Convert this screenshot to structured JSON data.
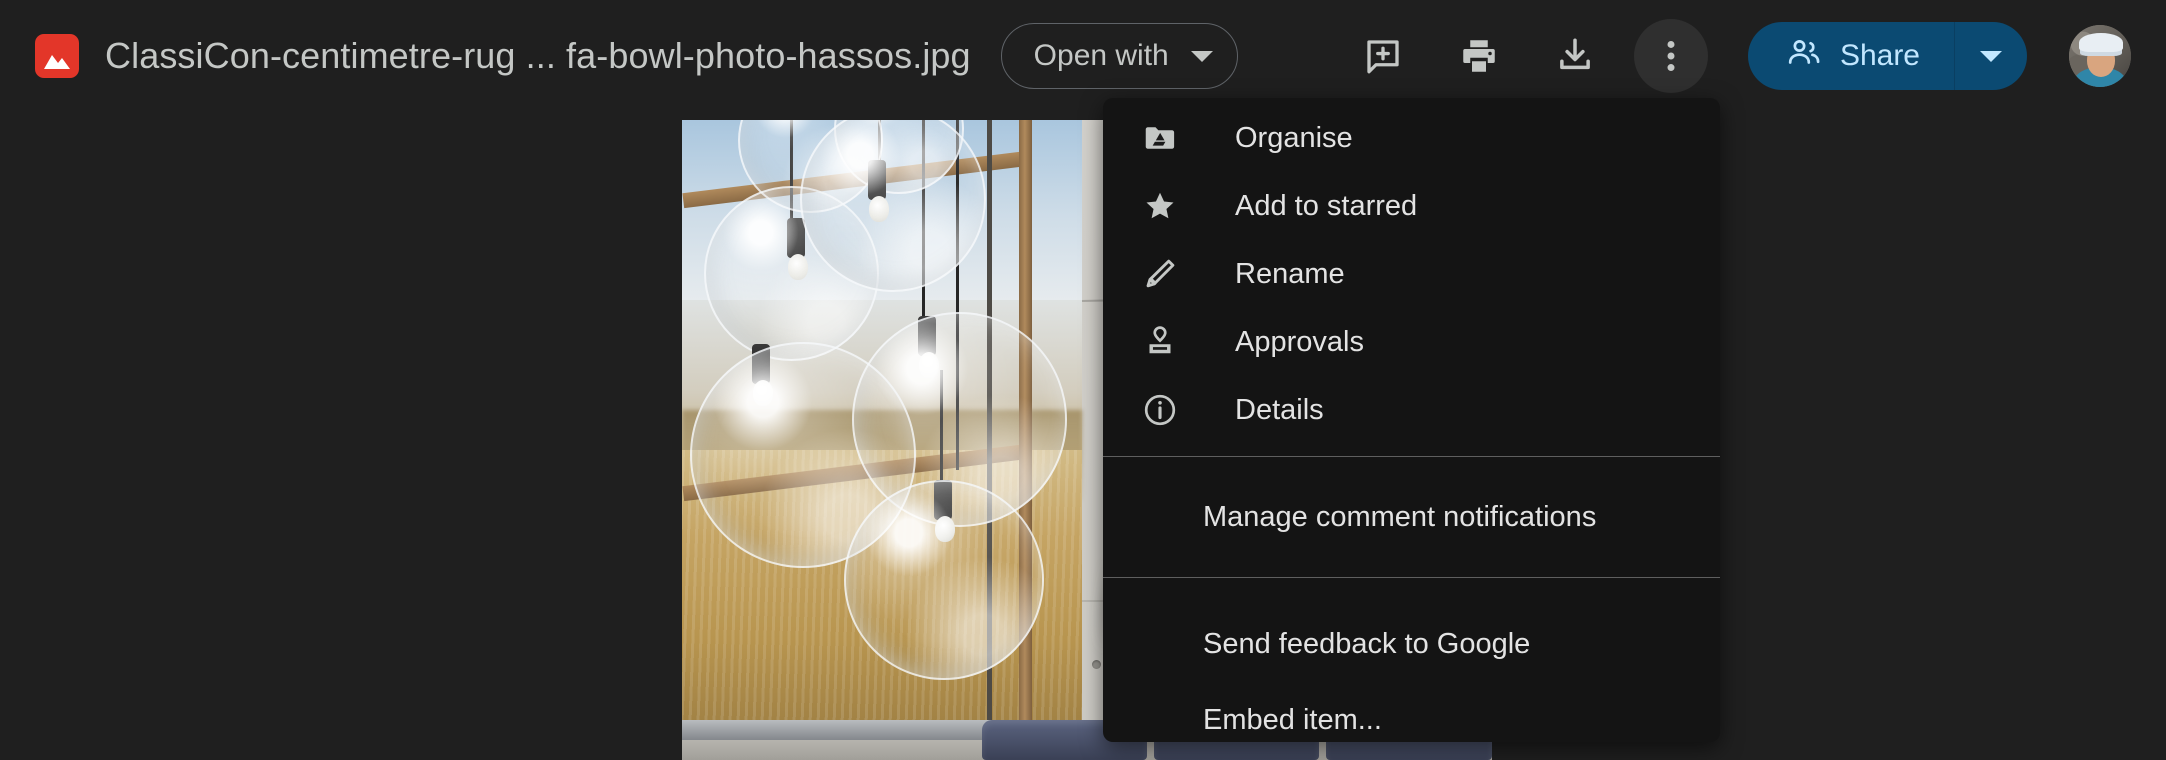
{
  "app": {
    "background_color": "#1f1f1f",
    "file_type_icon": "image-file-icon",
    "title": "ClassiCon-centimetre-rug ... fa-bowl-photo-hassos.jpg"
  },
  "toolbar": {
    "open_with": {
      "label": "Open with",
      "caret_icon": "chevron-down-icon"
    },
    "actions": [
      {
        "name": "add-comment-icon",
        "tooltip": "Add a comment"
      },
      {
        "name": "print-icon",
        "tooltip": "Print"
      },
      {
        "name": "download-icon",
        "tooltip": "Download"
      },
      {
        "name": "more-actions-icon",
        "tooltip": "More actions",
        "active": true
      }
    ],
    "share": {
      "label": "Share",
      "icon": "people-icon",
      "caret_icon": "chevron-down-icon",
      "background_color": "#0b4a72",
      "text_color": "#c2e7ff"
    },
    "avatar": {
      "name": "account-avatar",
      "alt": "Account profile photo"
    }
  },
  "menu": {
    "background_color": "#141414",
    "groups": [
      {
        "items": [
          {
            "label": "Organise",
            "icon": "drive-folder-icon"
          },
          {
            "label": "Add to starred",
            "icon": "star-icon"
          },
          {
            "label": "Rename",
            "icon": "pencil-icon"
          },
          {
            "label": "Approvals",
            "icon": "stamp-icon"
          },
          {
            "label": "Details",
            "icon": "info-circle-icon"
          }
        ]
      },
      {
        "items": [
          {
            "label": "Manage comment notifications",
            "icon": ""
          }
        ]
      },
      {
        "items": [
          {
            "label": "Send feedback to Google",
            "icon": ""
          },
          {
            "label": "Embed item...",
            "icon": ""
          }
        ]
      }
    ]
  },
  "preview": {
    "name": "image-preview",
    "description": "Interior photograph: clear glass globe pendant lights hanging in front of a wooden-framed window with an autumn field outside, beside a grey concrete wall, with a dark blue sofa below."
  }
}
